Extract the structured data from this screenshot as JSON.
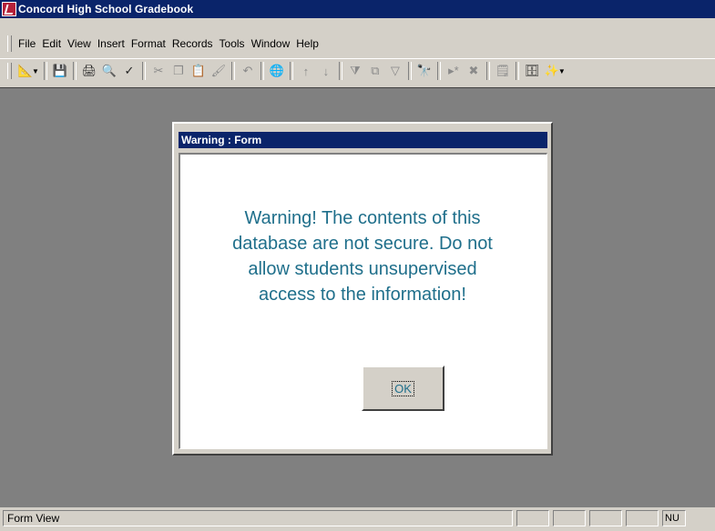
{
  "window": {
    "title": "Concord High School Gradebook"
  },
  "menu": [
    {
      "label": "File"
    },
    {
      "label": "Edit"
    },
    {
      "label": "View"
    },
    {
      "label": "Insert"
    },
    {
      "label": "Format"
    },
    {
      "label": "Records"
    },
    {
      "label": "Tools"
    },
    {
      "label": "Window"
    },
    {
      "label": "Help"
    }
  ],
  "toolbar": {
    "icons": [
      "design-view-icon",
      "save-icon",
      "print-icon",
      "print-preview-icon",
      "spelling-icon",
      "cut-icon",
      "copy-icon",
      "paste-icon",
      "format-painter-icon",
      "undo-icon",
      "insert-hyperlink-icon",
      "sort-ascending-icon",
      "sort-descending-icon",
      "filter-by-selection-icon",
      "filter-by-form-icon",
      "apply-filter-icon",
      "find-icon",
      "new-record-icon",
      "delete-record-icon",
      "properties-icon",
      "database-window-icon",
      "new-object-icon"
    ]
  },
  "dialog": {
    "title": "Warning : Form",
    "message": "Warning!  The contents of this\ndatabase are not secure.  Do not\nallow students unsupervised\naccess to the information!",
    "ok_label": "OK",
    "text_color": "#1f6f8b"
  },
  "status": {
    "text": "Form View",
    "indicator": "NU"
  },
  "colors": {
    "titlebar": "#0a246a",
    "chrome": "#d4d0c8",
    "workspace": "#808080"
  }
}
